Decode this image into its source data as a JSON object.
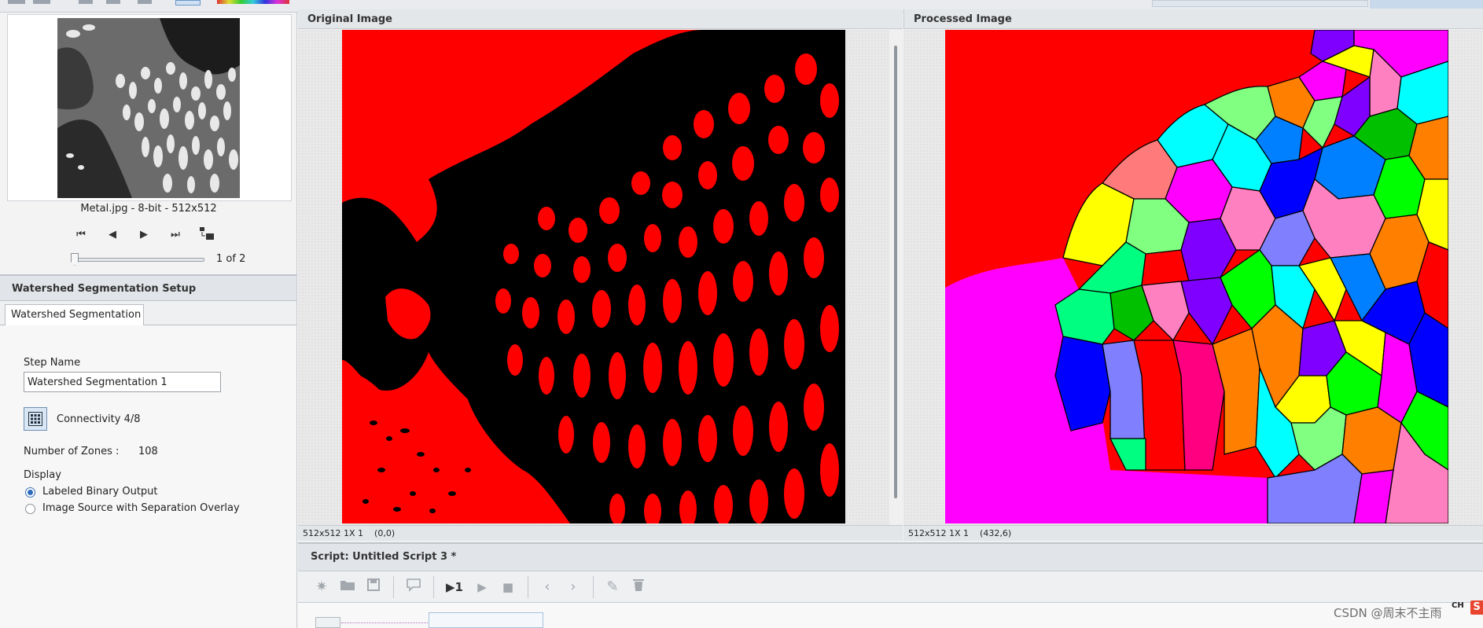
{
  "thumbnail": {
    "caption": "Metal.jpg - 8-bit - 512x512",
    "page_indicator": "1 of 2",
    "page_fraction": 0.0
  },
  "setup": {
    "title": "Watershed Segmentation Setup",
    "tab_label": "Watershed Segmentation",
    "step_name_label": "Step Name",
    "step_name_value": "Watershed Segmentation 1",
    "connectivity_label": "Connectivity 4/8",
    "zones_label": "Number of Zones :",
    "zones_value": "108",
    "display_label": "Display",
    "display_options": [
      {
        "label": "Labeled Binary Output",
        "selected": true
      },
      {
        "label": "Image Source with Separation Overlay",
        "selected": false
      }
    ]
  },
  "original_panel": {
    "title": "Original Image",
    "status_size": "512x512 1X 1",
    "status_coord": "(0,0)"
  },
  "processed_panel": {
    "title": "Processed Image",
    "status_size": "512x512 1X 1",
    "status_coord": "(432,6)"
  },
  "script": {
    "title": "Script: Untitled Script 3 *",
    "toolbar": [
      "new-icon",
      "open-folder-icon",
      "save-icon",
      "comment-icon",
      "run-step-icon",
      "run-icon",
      "stop-icon",
      "back-icon",
      "forward-icon",
      "edit-icon",
      "delete-icon"
    ],
    "run_step_label": "▶1"
  },
  "overlay": {
    "watermark": "CSDN @周末不主雨",
    "ime": "CH"
  },
  "colors": {
    "segment_red": "#ff0000",
    "background_black": "#000000",
    "magenta": "#ff00ff",
    "accent_blue": "#2d6bbf"
  }
}
